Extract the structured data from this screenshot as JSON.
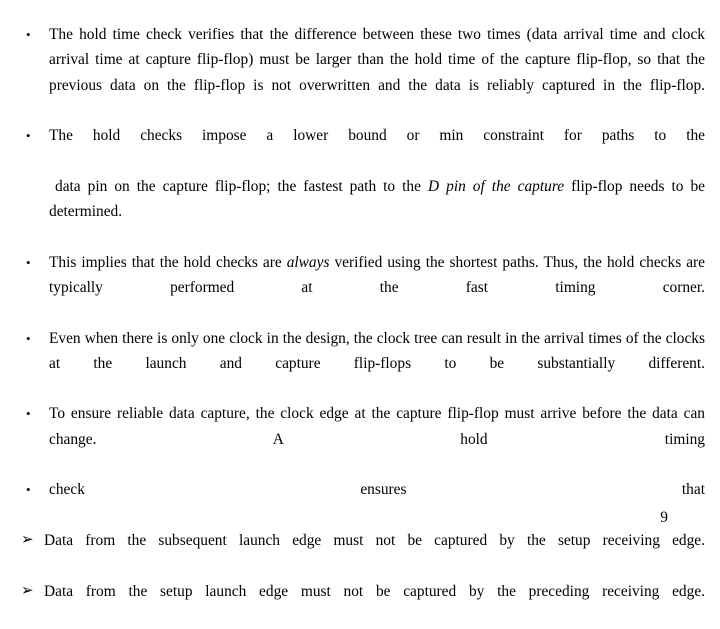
{
  "slide": {
    "page_number": "9",
    "background_color": "#ffffff",
    "text_color": "#000000",
    "bullets": [
      {
        "marker": "•",
        "marker_type": "dot",
        "runs": [
          {
            "text": "The hold time check verifies that the difference between these two times (data arrival time and clock arrival time at capture flip-flop) must be larger than the hold time of the capture flip-flop, so that the previous data on the flip-flop is not overwritten and the data is reliably captured in the flip-flop.",
            "style": "normal"
          }
        ]
      },
      {
        "marker": "•",
        "marker_type": "dot",
        "runs": [
          {
            "text": "The hold checks impose a lower bound or min constraint for paths to the",
            "style": "normal"
          }
        ]
      },
      {
        "marker": "",
        "marker_type": "none",
        "runs": [
          {
            "text": " data pin on the capture flip-flop; the fastest path to the ",
            "style": "normal"
          },
          {
            "text": "D pin of the capture",
            "style": "italic"
          },
          {
            "text": " flip-flop needs to be determined.",
            "style": "normal"
          }
        ]
      },
      {
        "marker": "•",
        "marker_type": "dot",
        "runs": [
          {
            "text": "This implies that the hold checks are ",
            "style": "normal"
          },
          {
            "text": "always",
            "style": "italic"
          },
          {
            "text": " verified using the shortest paths. Thus, the hold checks are typically performed at the fast timing corner.",
            "style": "normal"
          }
        ]
      },
      {
        "marker": "•",
        "marker_type": "dot",
        "runs": [
          {
            "text": "Even when there is only one clock in the design, the clock tree can result in the arrival times of the clocks at the launch and capture flip-flops to be substantially different.",
            "style": "normal"
          }
        ]
      },
      {
        "marker": "•",
        "marker_type": "dot",
        "runs": [
          {
            "text": "To ensure reliable data capture, the clock edge at the capture flip-flop must arrive before the data can change. A hold timing",
            "style": "normal"
          }
        ]
      },
      {
        "marker": "•",
        "marker_type": "dot",
        "runs": [
          {
            "text": "check ensures that",
            "style": "normal"
          }
        ]
      },
      {
        "marker": "➢",
        "marker_type": "arrow",
        "runs": [
          {
            "text": " Data from the subsequent launch edge must not be captured by the setup receiving edge.",
            "style": "normal"
          }
        ]
      },
      {
        "marker": "➢",
        "marker_type": "arrow",
        "runs": [
          {
            "text": " Data from the setup launch edge must not be captured by the preceding receiving edge.",
            "style": "normal"
          }
        ]
      }
    ]
  }
}
